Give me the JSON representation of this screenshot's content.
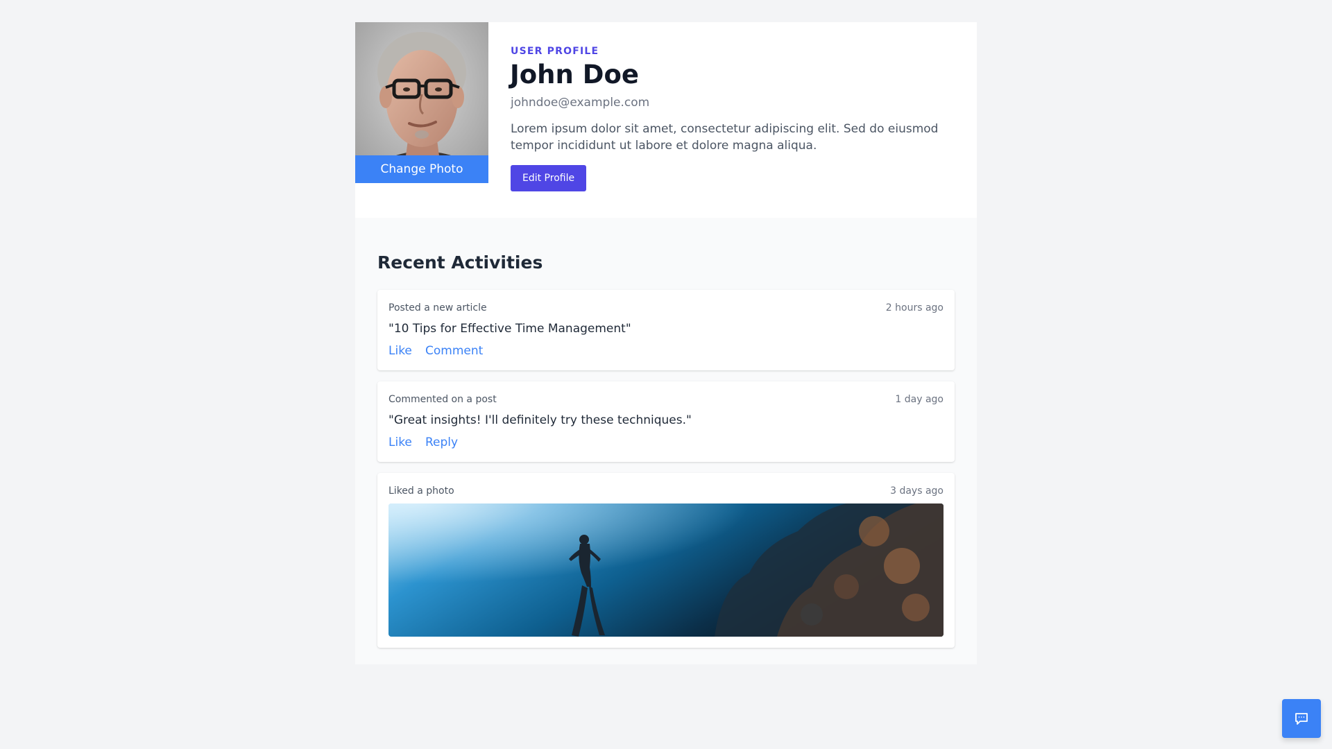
{
  "profile": {
    "eyebrow": "USER PROFILE",
    "name": "John Doe",
    "email": "johndoe@example.com",
    "bio": "Lorem ipsum dolor sit amet, consectetur adipiscing elit. Sed do eiusmod tempor incididunt ut labore et dolore magna aliqua.",
    "change_photo_label": "Change Photo",
    "edit_profile_label": "Edit Profile"
  },
  "activities": {
    "title": "Recent Activities",
    "items": [
      {
        "type": "Posted a new article",
        "time": "2 hours ago",
        "content": "\"10 Tips for Effective Time Management\"",
        "actions": [
          "Like",
          "Comment"
        ]
      },
      {
        "type": "Commented on a post",
        "time": "1 day ago",
        "content": "\"Great insights! I'll definitely try these techniques.\"",
        "actions": [
          "Like",
          "Reply"
        ]
      },
      {
        "type": "Liked a photo",
        "time": "3 days ago"
      }
    ]
  },
  "icons": {
    "chat": "chat-bubble-icon"
  },
  "colors": {
    "accent": "#4f46e5",
    "link": "#3b82f6",
    "page_bg": "#f3f4f6"
  }
}
